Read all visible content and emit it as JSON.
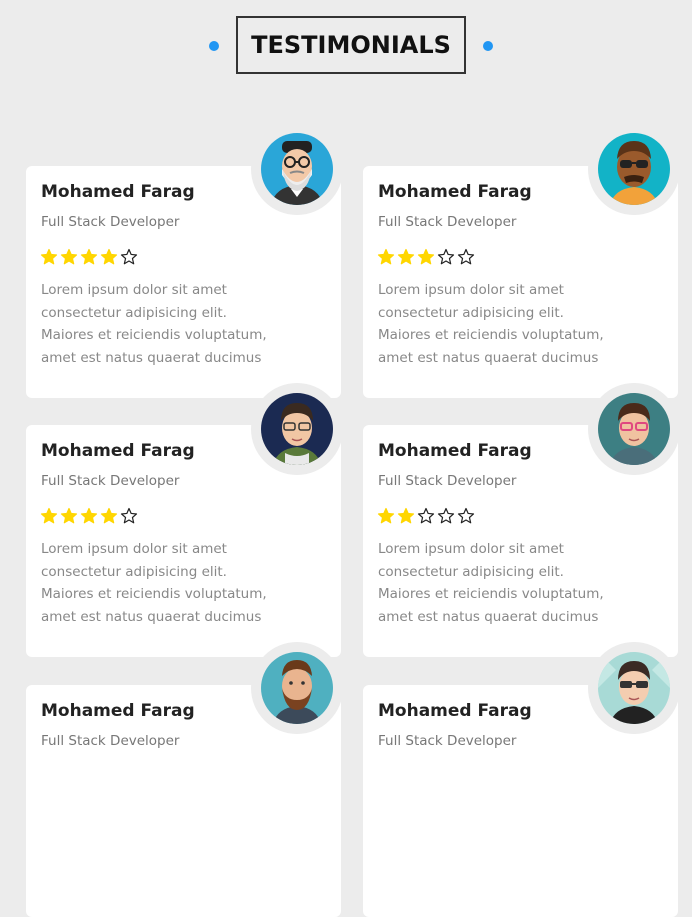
{
  "section": {
    "title": "TESTIMONIALS",
    "accent_color": "#2196f3",
    "star_color": "#ffd600"
  },
  "testimonials": [
    {
      "name": "Mohamed Farag",
      "role": "Full Stack Developer",
      "rating": 4,
      "max_rating": 5,
      "text": "Lorem ipsum dolor sit amet consectetur adipisicing elit. Maiores et reiciendis voluptatum, amet est natus quaerat ducimus",
      "avatar": "avatar-hipster-beard-icon"
    },
    {
      "name": "Mohamed Farag",
      "role": "Full Stack Developer",
      "rating": 3,
      "max_rating": 5,
      "text": "Lorem ipsum dolor sit amet consectetur adipisicing elit. Maiores et reiciendis voluptatum, amet est natus quaerat ducimus",
      "avatar": "avatar-sunglasses-man-icon"
    },
    {
      "name": "Mohamed Farag",
      "role": "Full Stack Developer",
      "rating": 4,
      "max_rating": 5,
      "text": "Lorem ipsum dolor sit amet consectetur adipisicing elit. Maiores et reiciendis voluptatum, amet est natus quaerat ducimus",
      "avatar": "avatar-glasses-man-icon"
    },
    {
      "name": "Mohamed Farag",
      "role": "Full Stack Developer",
      "rating": 2,
      "max_rating": 5,
      "text": "Lorem ipsum dolor sit amet consectetur adipisicing elit. Maiores et reiciendis voluptatum, amet est natus quaerat ducimus",
      "avatar": "avatar-pink-glasses-man-icon"
    },
    {
      "name": "Mohamed Farag",
      "role": "Full Stack Developer",
      "rating": 0,
      "max_rating": 5,
      "text": "",
      "avatar": "avatar-bearded-man-icon"
    },
    {
      "name": "Mohamed Farag",
      "role": "Full Stack Developer",
      "rating": 0,
      "max_rating": 5,
      "text": "",
      "avatar": "avatar-dark-glasses-man-icon"
    }
  ]
}
